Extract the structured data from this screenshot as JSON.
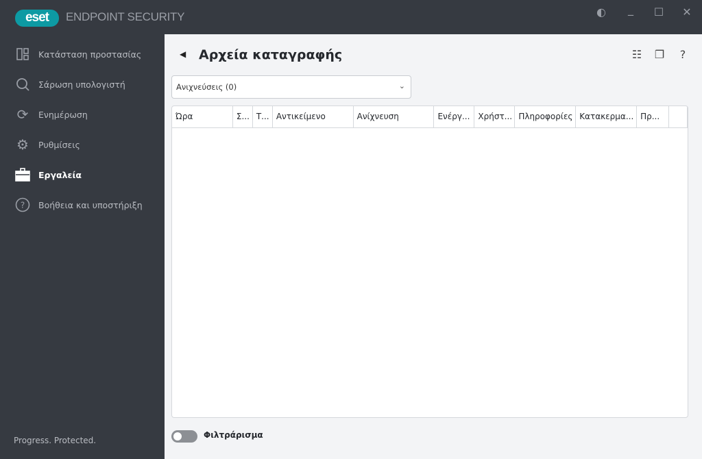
{
  "app": {
    "logo": "eset",
    "product": "ENDPOINT SECURITY"
  },
  "window": {
    "theme_icon": "half-circle-icon",
    "minimize": "minimize-icon",
    "maximize": "maximize-icon",
    "close": "close-icon"
  },
  "sidebar": {
    "items": [
      {
        "label": "Κατάσταση προστασίας",
        "icon": "dashboard-icon"
      },
      {
        "label": "Σάρωση υπολογιστή",
        "icon": "search-icon"
      },
      {
        "label": "Ενημέρωση",
        "icon": "refresh-icon"
      },
      {
        "label": "Ρυθμίσεις",
        "icon": "gear-icon"
      },
      {
        "label": "Εργαλεία",
        "icon": "toolbox-icon",
        "active": true
      },
      {
        "label": "Βοήθεια και υποστήριξη",
        "icon": "help-circle-icon"
      }
    ],
    "footer": "Progress. Protected."
  },
  "main": {
    "title": "Αρχεία καταγραφής",
    "select_value": "Ανιχνεύσεις (0)",
    "columns": [
      "Ώρα",
      "Σ...",
      "Τ...",
      "Αντικείμενο",
      "Ανίχνευση",
      "Ενέργ...",
      "Χρήστ...",
      "Πληροφορίες",
      "Κατακερμα...",
      "Πρ...",
      ""
    ],
    "filter_label": "Φιλτράρισμα",
    "filter_on": false
  }
}
